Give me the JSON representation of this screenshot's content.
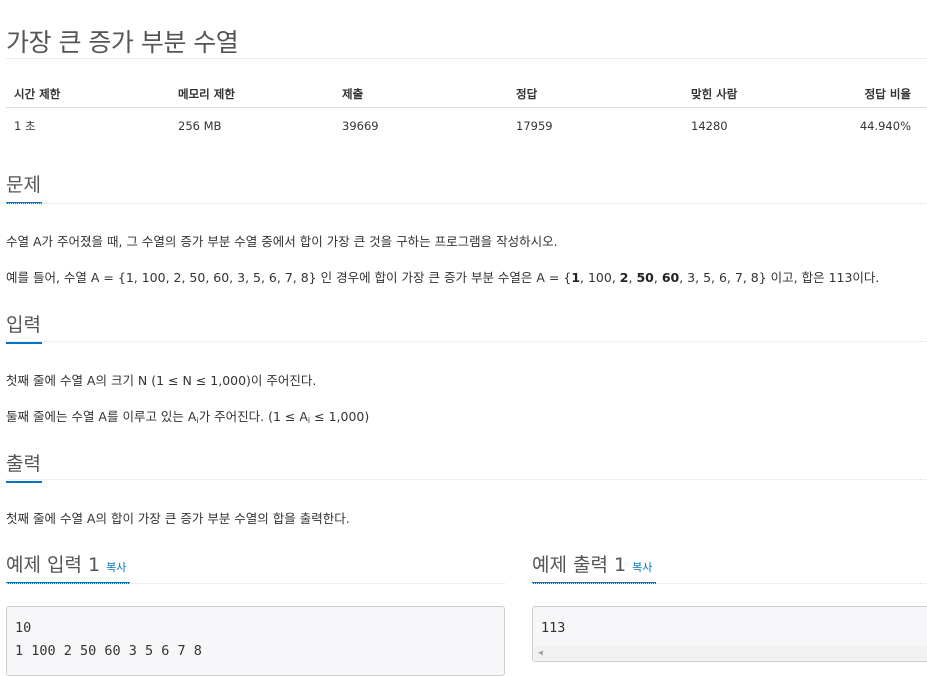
{
  "problem": {
    "title": "가장 큰 증가 부분 수열"
  },
  "stats": {
    "headers": [
      "시간 제한",
      "메모리 제한",
      "제출",
      "정답",
      "맞힌 사람",
      "정답 비율"
    ],
    "values": [
      "1 초",
      "256 MB",
      "39669",
      "17959",
      "14280",
      "44.940%"
    ]
  },
  "sections": {
    "description": {
      "heading": "문제",
      "line1": "수열 A가 주어졌을 때, 그 수열의 증가 부분 수열 중에서 합이 가장 큰 것을 구하는 프로그램을 작성하시오.",
      "line2": {
        "prefix": "예를 들어, 수열 A = {1, 100, 2, 50, 60, 3, 5, 6, 7, 8} 인 경우에 합이 가장 큰 증가 부분 수열은 A = {",
        "b1": "1",
        "t1": ", 100, ",
        "b2": "2",
        "t2": ", ",
        "b3": "50",
        "t3": ", ",
        "b4": "60",
        "suffix": ", 3, 5, 6, 7, 8} 이고, 합은 113이다."
      }
    },
    "input": {
      "heading": "입력",
      "line1": "첫째 줄에 수열 A의 크기 N (1 ≤ N ≤ 1,000)이 주어진다.",
      "line2_prefix": "둘째 줄에는 수열 A를 이루고 있는 A",
      "line2_sub": "i",
      "line2_suffix": "가 주어진다. (1 ≤ A",
      "line2_sub2": "i",
      "line2_end": " ≤ 1,000)"
    },
    "output": {
      "heading": "출력",
      "line1": "첫째 줄에 수열 A의 합이 가장 큰 증가 부분 수열의 합을 출력한다."
    }
  },
  "examples": {
    "input": {
      "heading": "예제 입력 1",
      "copy_label": "복사",
      "content": "10\n1 100 2 50 60 3 5 6 7 8"
    },
    "output": {
      "heading": "예제 출력 1",
      "copy_label": "복사",
      "content": "113"
    }
  }
}
